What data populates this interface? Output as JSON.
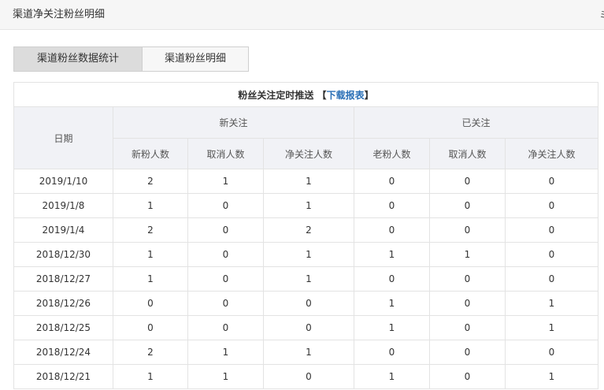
{
  "header": {
    "title": "渠道净关注粉丝明细",
    "edge_glyph": "ミ"
  },
  "tabs": [
    {
      "label": "渠道粉丝数据统计",
      "active": true
    },
    {
      "label": "渠道粉丝明细",
      "active": false
    }
  ],
  "table": {
    "caption": "粉丝关注定时推送",
    "bracket_open": "【",
    "download_link": "下载报表",
    "bracket_close": "】",
    "date_header": "日期",
    "group_headers": [
      "新关注",
      "已关注"
    ],
    "sub_headers": [
      "新粉人数",
      "取消人数",
      "净关注人数",
      "老粉人数",
      "取消人数",
      "净关注人数"
    ],
    "rows": [
      [
        "2019/1/10",
        "2",
        "1",
        "1",
        "0",
        "0",
        "0"
      ],
      [
        "2019/1/8",
        "1",
        "0",
        "1",
        "0",
        "0",
        "0"
      ],
      [
        "2019/1/4",
        "2",
        "0",
        "2",
        "0",
        "0",
        "0"
      ],
      [
        "2018/12/30",
        "1",
        "0",
        "1",
        "1",
        "1",
        "0"
      ],
      [
        "2018/12/27",
        "1",
        "0",
        "1",
        "0",
        "0",
        "0"
      ],
      [
        "2018/12/26",
        "0",
        "0",
        "0",
        "1",
        "0",
        "1"
      ],
      [
        "2018/12/25",
        "0",
        "0",
        "0",
        "1",
        "0",
        "1"
      ],
      [
        "2018/12/24",
        "2",
        "1",
        "1",
        "0",
        "0",
        "0"
      ],
      [
        "2018/12/21",
        "1",
        "1",
        "0",
        "1",
        "0",
        "1"
      ]
    ]
  },
  "colors": {
    "link": "#2a6fb6",
    "header_bg": "#f1f2f6",
    "active_tab": "#dcdcdc"
  }
}
